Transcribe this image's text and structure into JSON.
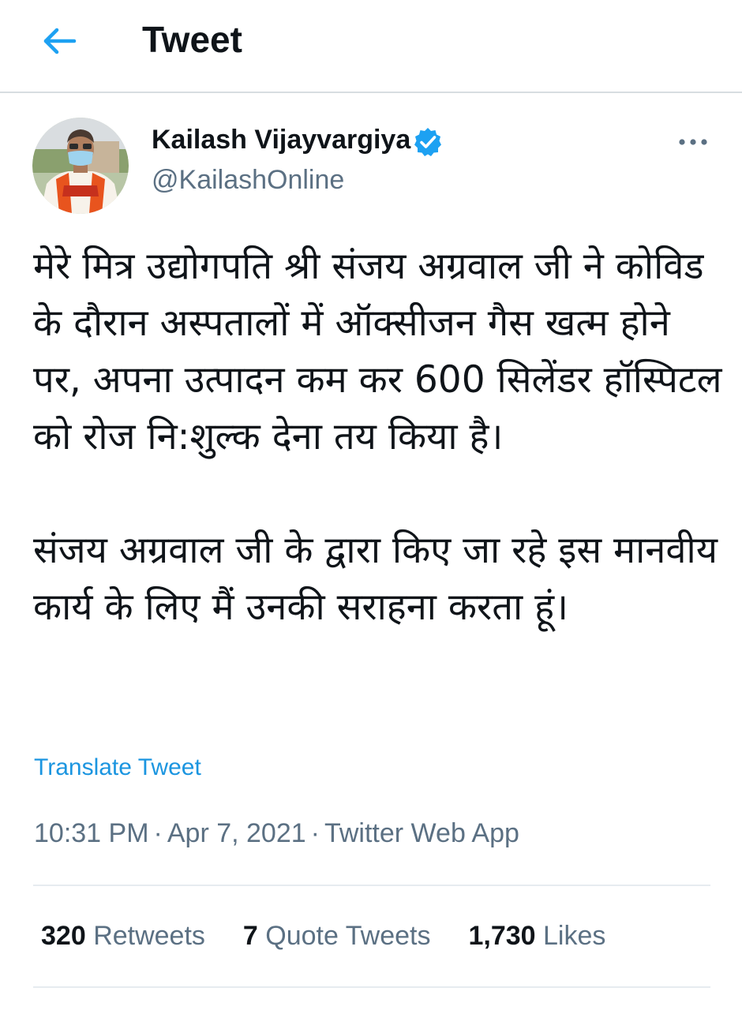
{
  "header": {
    "title": "Tweet",
    "back_icon": "arrow-left-icon",
    "accent_color": "#1da1f2"
  },
  "author": {
    "display_name": "Kailash Vijayvargiya",
    "handle": "@KailashOnline",
    "verified": true,
    "verified_icon": "verified-badge-icon",
    "more_icon": "more-horizontal-icon"
  },
  "tweet": {
    "text": "मेरे मित्र उद्योगपति श्री संजय अग्रवाल जी ने कोविड के दौरान अस्पतालों में ऑक्सीजन गैस खत्म होने पर, अपना उत्पादन कम कर 600 सिलेंडर हॉस्पिटल को रोज नि:शुल्क देना तय किया है।\n\nसंजय अग्रवाल जी के द्वारा किए जा रहे इस मानवीय कार्य के लिए मैं उनकी सराहना करता हूं।",
    "translate_label": "Translate Tweet",
    "time": "10:31 PM",
    "date": "Apr 7, 2021",
    "source": "Twitter Web App",
    "separator": "·"
  },
  "stats": {
    "retweets_count": "320",
    "retweets_label": "Retweets",
    "quotes_count": "7",
    "quotes_label": "Quote Tweets",
    "likes_count": "1,730",
    "likes_label": "Likes"
  },
  "colors": {
    "text_primary": "#0f1419",
    "text_secondary": "#5b7083",
    "link": "#1b95e0",
    "divider": "#e6ecf0"
  }
}
